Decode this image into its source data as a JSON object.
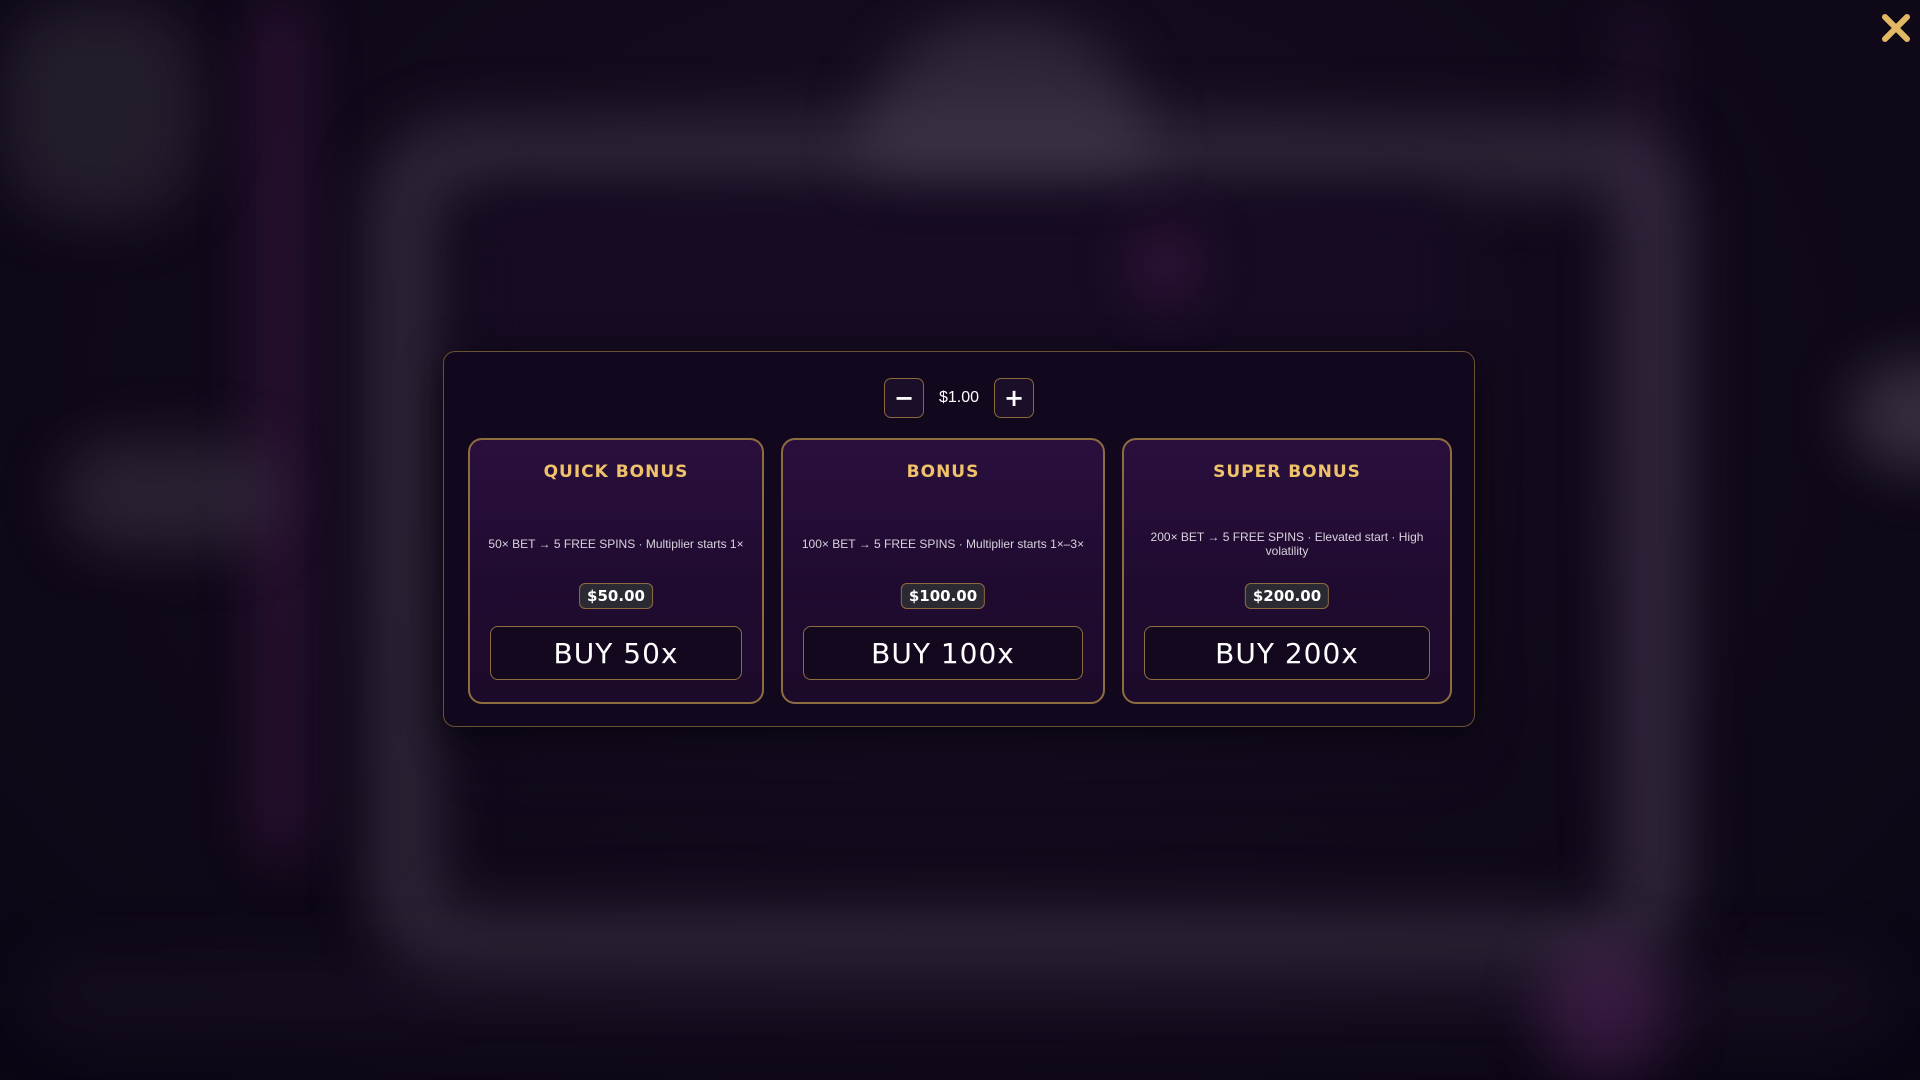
{
  "stepper": {
    "minus_label": "−",
    "plus_label": "+",
    "bet_value": "$1.00"
  },
  "cards": [
    {
      "title": "QUICK BONUS",
      "description": "50× BET → 5 FREE SPINS · Multiplier starts 1×",
      "price": "$50.00",
      "buy_label": "BUY 50x"
    },
    {
      "title": "BONUS",
      "description": "100× BET → 5 FREE SPINS · Multiplier starts 1×–3×",
      "price": "$100.00",
      "buy_label": "BUY 100x"
    },
    {
      "title": "SUPER BONUS",
      "description": "200× BET → 5 FREE SPINS · Elevated start · High volatility",
      "price": "$200.00",
      "buy_label": "BUY 200x"
    }
  ],
  "close": {
    "icon": "close-icon"
  },
  "colors": {
    "accent_gold": "#f0c36a",
    "border_gold": "#8d6c40",
    "close_icon": "#e2b864"
  }
}
